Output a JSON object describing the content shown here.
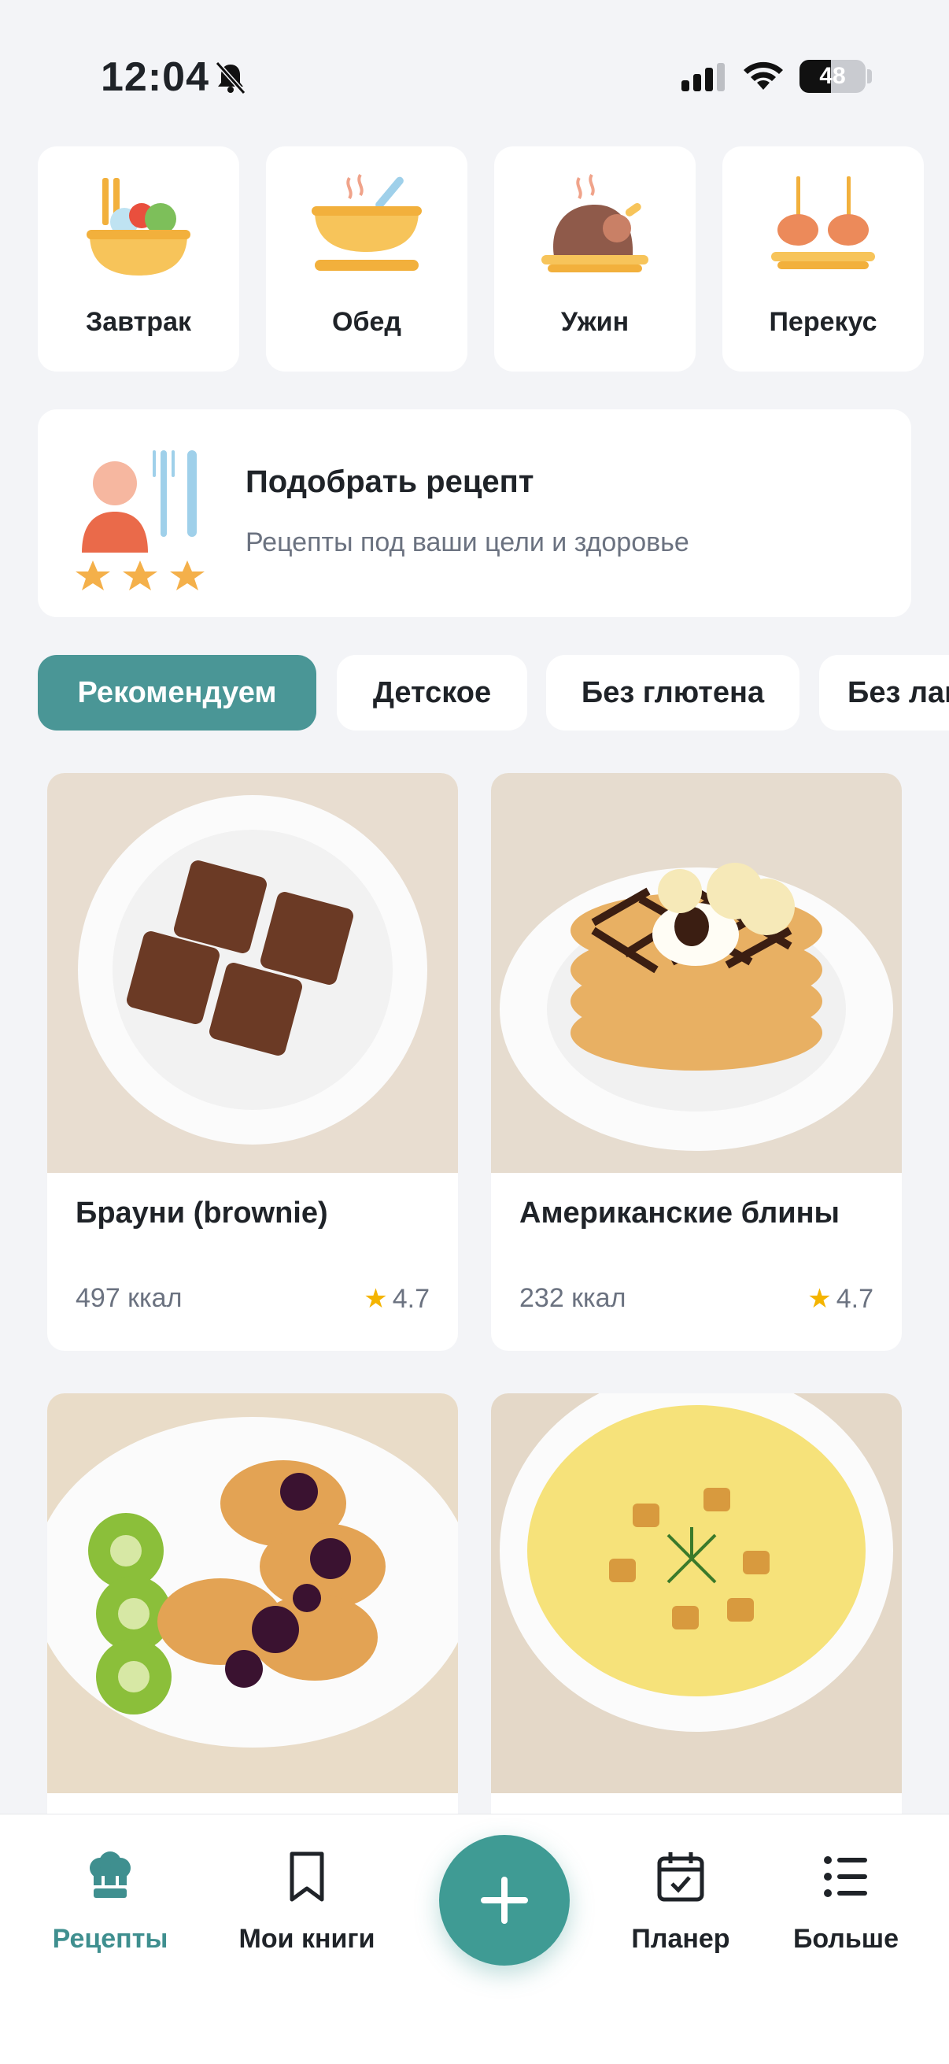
{
  "status_bar": {
    "time": "12:04",
    "battery": "48",
    "battery_level": 0.48
  },
  "categories": [
    {
      "label": "Завтрак",
      "icon": "breakfast-bowl-icon"
    },
    {
      "label": "Обед",
      "icon": "soup-bowl-icon"
    },
    {
      "label": "Ужин",
      "icon": "roast-chicken-icon"
    },
    {
      "label": "Перекус",
      "icon": "snack-skewers-icon"
    }
  ],
  "picker": {
    "title": "Подобрать рецепт",
    "subtitle": "Рецепты под ваши цели и здоровье",
    "icon": "chef-rating-icon"
  },
  "filters": [
    {
      "label": "Рекомендуем",
      "active": true
    },
    {
      "label": "Детское",
      "active": false
    },
    {
      "label": "Без глютена",
      "active": false
    },
    {
      "label": "Без лактозы",
      "active": false
    }
  ],
  "recipes": [
    {
      "name": "Брауни (brownie)",
      "kcal": "497 ккал",
      "rating": "4.7",
      "image": "brownie-photo"
    },
    {
      "name": "Американские блины",
      "kcal": "232 ккал",
      "rating": "4.7",
      "image": "pancakes-photo"
    },
    {
      "name": "",
      "kcal": "",
      "rating": "",
      "image": "kiwi-fritters-photo"
    },
    {
      "name": "",
      "kcal": "",
      "rating": "",
      "image": "cream-soup-photo"
    }
  ],
  "tabbar": {
    "tabs": [
      {
        "label": "Рецепты",
        "icon": "chef-hat-icon",
        "active": true
      },
      {
        "label": "Мои книги",
        "icon": "bookmark-icon",
        "active": false
      },
      {
        "label": "Планер",
        "icon": "calendar-check-icon",
        "active": false
      },
      {
        "label": "Больше",
        "icon": "list-icon",
        "active": false
      }
    ],
    "fab_icon": "plus-icon"
  },
  "colors": {
    "accent": "#4a9696",
    "star": "#f4b400",
    "background": "#f3f4f7"
  }
}
